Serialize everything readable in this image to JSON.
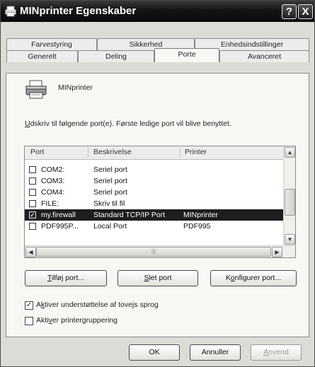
{
  "window": {
    "title": "MINprinter Egenskaber",
    "help_label": "?",
    "close_label": "X"
  },
  "tabs": {
    "row1": [
      "Farvestyring",
      "Sikkerhed",
      "Enhedsindstillinger"
    ],
    "row2": [
      "Generelt",
      "Deling",
      "Porte",
      "Avanceret"
    ],
    "active": "Porte"
  },
  "printer_name": "MINprinter",
  "instruction": {
    "hotkey": "U",
    "rest": "dskriv til følgende port(e). Første ledige port vil blive benyttet."
  },
  "port_list": {
    "columns": [
      "Port",
      "Beskrivelse",
      "Printer"
    ],
    "rows": [
      {
        "port": "COM2:",
        "description": "Seriel port",
        "printer": "",
        "checked": false,
        "selected": false
      },
      {
        "port": "COM3:",
        "description": "Seriel port",
        "printer": "",
        "checked": false,
        "selected": false
      },
      {
        "port": "COM4:",
        "description": "Seriel port",
        "printer": "",
        "checked": false,
        "selected": false
      },
      {
        "port": "FILE:",
        "description": "Skriv til fil",
        "printer": "",
        "checked": false,
        "selected": false
      },
      {
        "port": "my.firewall",
        "description": "Standard TCP/IP Port",
        "printer": "MINprinter",
        "checked": true,
        "selected": true
      },
      {
        "port": "PDF995P...",
        "description": "Local Port",
        "printer": "PDF995",
        "checked": false,
        "selected": false
      }
    ]
  },
  "buttons": {
    "add_port": {
      "hotkey": "T",
      "rest": "ilføj port..."
    },
    "delete_port": {
      "hotkey": "S",
      "rest": "let port"
    },
    "configure_port": {
      "pre": "K",
      "hotkey": "o",
      "rest": "nfigurer port..."
    }
  },
  "options": {
    "bidirectional": {
      "pre": "A",
      "hotkey": "k",
      "rest": "tiver understøttelse af tovejs sprog",
      "checked": true
    },
    "pooling": {
      "pre": "Akti",
      "hotkey": "v",
      "rest": "er printergruppering",
      "checked": false
    }
  },
  "footer": {
    "ok_label": "OK",
    "cancel_label": "Annuller",
    "apply_hotkey": "A",
    "apply_rest": "nvend"
  },
  "colors": {
    "selection": "#1e1e1e",
    "titlebar": "#141414"
  }
}
